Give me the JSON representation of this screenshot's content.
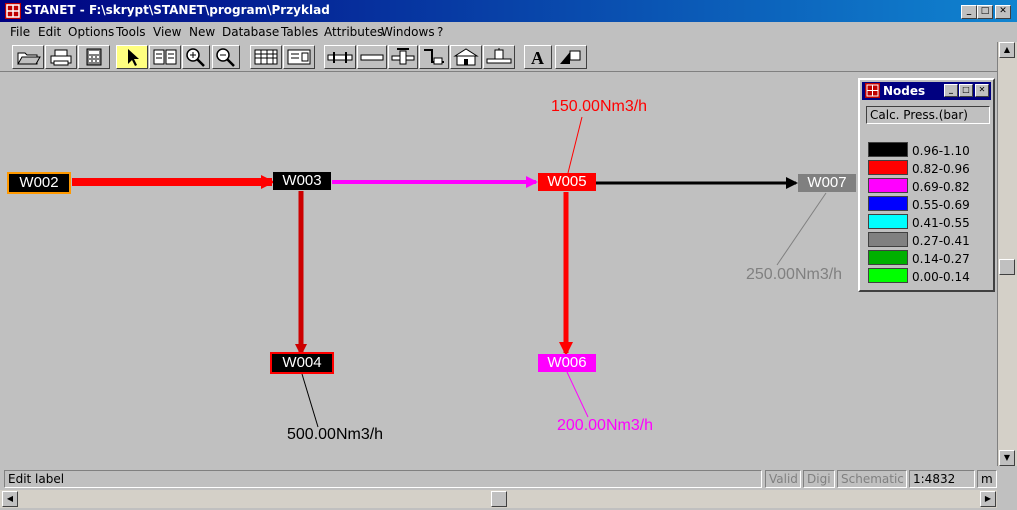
{
  "window": {
    "title": "STANET - F:\\skrypt\\STANET\\program\\Przyklad"
  },
  "menu": {
    "items": [
      "File",
      "Edit",
      "Options",
      "Tools",
      "View",
      "New",
      "Database",
      "Tables",
      "Attributes",
      "Windows",
      "?"
    ]
  },
  "toolbar": {
    "buttons": [
      "open-icon",
      "print-icon",
      "calculator-icon",
      "select-arrow-icon",
      "layout-icon",
      "zoom-in-icon",
      "zoom-out-icon",
      "table-icon",
      "form-icon",
      "pipe-icon",
      "pipe-segment-icon",
      "valve-icon",
      "pump-icon",
      "building-icon",
      "station-icon",
      "text-icon",
      "shape-icon"
    ]
  },
  "network": {
    "nodes": [
      {
        "id": "W002",
        "color": "#000000",
        "border": "#ff9900"
      },
      {
        "id": "W003",
        "color": "#000000",
        "border": "#000000"
      },
      {
        "id": "W004",
        "color": "#000000",
        "border": "#ff0000"
      },
      {
        "id": "W005",
        "color": "#ff0000",
        "border": "#ff0000"
      },
      {
        "id": "W006",
        "color": "#ff00ff",
        "border": "#ff00ff"
      },
      {
        "id": "W007",
        "color": "#808080",
        "border": "#808080"
      }
    ],
    "flows": [
      {
        "node": "W005",
        "text": "150.00Nm3/h",
        "color": "#ff0000"
      },
      {
        "node": "W007",
        "text": "250.00Nm3/h",
        "color": "#808080"
      },
      {
        "node": "W004",
        "text": "500.00Nm3/h",
        "color": "#000000"
      },
      {
        "node": "W006",
        "text": "200.00Nm3/h",
        "color": "#ff00ff"
      }
    ]
  },
  "nodes_panel": {
    "title": "Nodes",
    "header": "Calc. Press.(bar)",
    "legend": [
      {
        "label": "0.96-1.10",
        "color": "#000000"
      },
      {
        "label": "0.82-0.96",
        "color": "#ff0000"
      },
      {
        "label": "0.69-0.82",
        "color": "#ff00ff"
      },
      {
        "label": "0.55-0.69",
        "color": "#0000ff"
      },
      {
        "label": "0.41-0.55",
        "color": "#00ffff"
      },
      {
        "label": "0.27-0.41",
        "color": "#808080"
      },
      {
        "label": "0.14-0.27",
        "color": "#00b000"
      },
      {
        "label": "0.00-0.14",
        "color": "#00ff00"
      }
    ]
  },
  "status": {
    "message": "Edit label",
    "valid": "Valid",
    "digi": "Digi",
    "schematic": "Schematic",
    "scale": "1:4832",
    "unit": "m"
  }
}
